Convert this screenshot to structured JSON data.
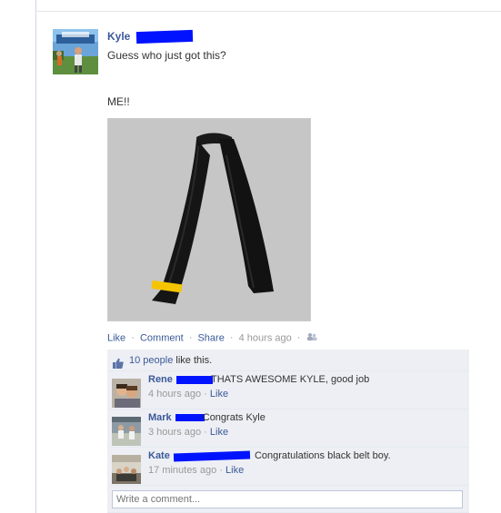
{
  "post": {
    "author": "Kyle",
    "text_line1": "Guess who just got this?",
    "text_line2": "ME!!",
    "photo_alt": "black belt with yellow stripe",
    "actions": {
      "like": "Like",
      "comment": "Comment",
      "share": "Share",
      "time": "4 hours ago",
      "sep": "·"
    }
  },
  "ufi": {
    "likes_count_text": "10 people",
    "likes_suffix": "like this.",
    "comments": [
      {
        "name": "Rene",
        "text": "THATS AWESOME KYLE, good job",
        "time": "4 hours ago",
        "like": "Like"
      },
      {
        "name": "Mark",
        "text": "Congrats Kyle",
        "time": "3 hours ago",
        "like": "Like"
      },
      {
        "name": "Kate",
        "text": "Congratulations black belt boy.",
        "time": "17 minutes ago",
        "like": "Like"
      }
    ],
    "compose_placeholder": "Write a comment..."
  },
  "colors": {
    "link": "#3b5998",
    "redaction": "#0013ff",
    "ufi_bg": "#edeff4"
  },
  "icons": [
    "thumbs-up-icon",
    "people-icon"
  ]
}
